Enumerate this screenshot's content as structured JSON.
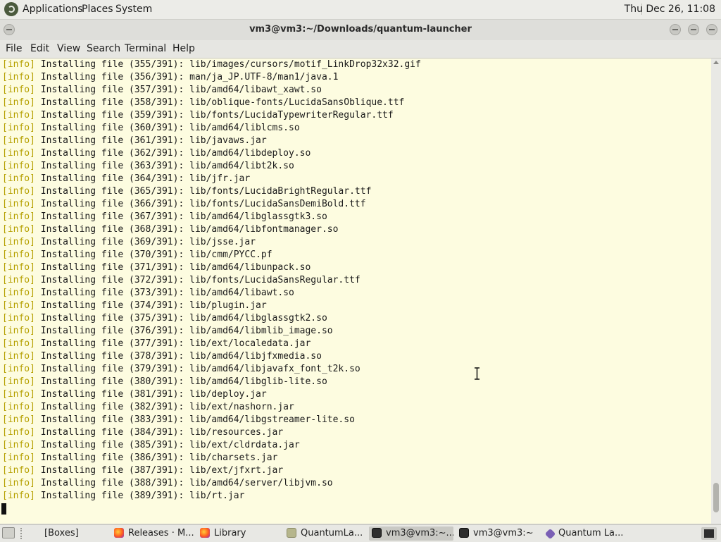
{
  "top_panel": {
    "menus": [
      "Applications",
      "Places",
      "System"
    ],
    "clock": "Thu Dec 26, 11:08"
  },
  "window": {
    "title": "vm3@vm3:~/Downloads/quantum-launcher"
  },
  "menubar": [
    "File",
    "Edit",
    "View",
    "Search",
    "Terminal",
    "Help"
  ],
  "terminal": {
    "tag": "[info]",
    "lines": [
      "Installing file (355/391): lib/images/cursors/motif_LinkDrop32x32.gif",
      "Installing file (356/391): man/ja_JP.UTF-8/man1/java.1",
      "Installing file (357/391): lib/amd64/libawt_xawt.so",
      "Installing file (358/391): lib/oblique-fonts/LucidaSansOblique.ttf",
      "Installing file (359/391): lib/fonts/LucidaTypewriterRegular.ttf",
      "Installing file (360/391): lib/amd64/liblcms.so",
      "Installing file (361/391): lib/javaws.jar",
      "Installing file (362/391): lib/amd64/libdeploy.so",
      "Installing file (363/391): lib/amd64/libt2k.so",
      "Installing file (364/391): lib/jfr.jar",
      "Installing file (365/391): lib/fonts/LucidaBrightRegular.ttf",
      "Installing file (366/391): lib/fonts/LucidaSansDemiBold.ttf",
      "Installing file (367/391): lib/amd64/libglassgtk3.so",
      "Installing file (368/391): lib/amd64/libfontmanager.so",
      "Installing file (369/391): lib/jsse.jar",
      "Installing file (370/391): lib/cmm/PYCC.pf",
      "Installing file (371/391): lib/amd64/libunpack.so",
      "Installing file (372/391): lib/fonts/LucidaSansRegular.ttf",
      "Installing file (373/391): lib/amd64/libawt.so",
      "Installing file (374/391): lib/plugin.jar",
      "Installing file (375/391): lib/amd64/libglassgtk2.so",
      "Installing file (376/391): lib/amd64/libmlib_image.so",
      "Installing file (377/391): lib/ext/localedata.jar",
      "Installing file (378/391): lib/amd64/libjfxmedia.so",
      "Installing file (379/391): lib/amd64/libjavafx_font_t2k.so",
      "Installing file (380/391): lib/amd64/libglib-lite.so",
      "Installing file (381/391): lib/deploy.jar",
      "Installing file (382/391): lib/ext/nashorn.jar",
      "Installing file (383/391): lib/amd64/libgstreamer-lite.so",
      "Installing file (384/391): lib/resources.jar",
      "Installing file (385/391): lib/ext/cldrdata.jar",
      "Installing file (386/391): lib/charsets.jar",
      "Installing file (387/391): lib/ext/jfxrt.jar",
      "Installing file (388/391): lib/amd64/server/libjvm.so",
      "Installing file (389/391): lib/rt.jar"
    ]
  },
  "taskbar": [
    {
      "label": "[Boxes]",
      "icon": "none",
      "active": false
    },
    {
      "label": "Releases · M...",
      "icon": "firefox-icon",
      "active": false
    },
    {
      "label": "Library",
      "icon": "firefox-icon",
      "active": false
    },
    {
      "label": "QuantumLa...",
      "icon": "folder-icon",
      "active": false
    },
    {
      "label": "vm3@vm3:~...",
      "icon": "terminal-icon",
      "active": true
    },
    {
      "label": "vm3@vm3:~",
      "icon": "terminal-icon",
      "active": false
    },
    {
      "label": "Quantum La...",
      "icon": "quantum-launcher-icon",
      "active": false
    }
  ],
  "colors": {
    "terminal_bg": "#fdfce0",
    "info_tag": "#b5a000"
  }
}
